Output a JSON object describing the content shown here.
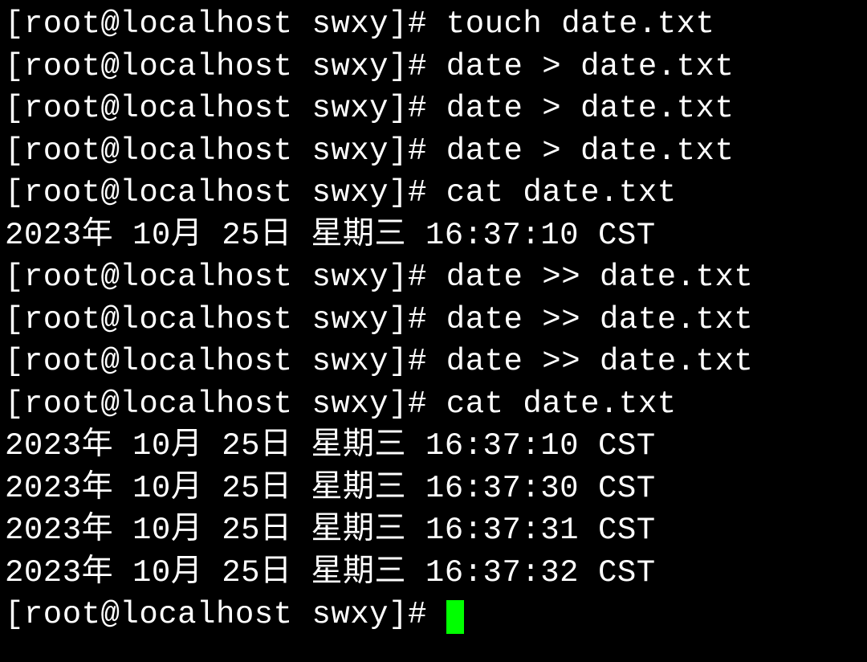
{
  "lines": {
    "l0": "[root@localhost swxy]# touch date.txt",
    "l1": "[root@localhost swxy]# date > date.txt",
    "l2": "[root@localhost swxy]# date > date.txt",
    "l3": "[root@localhost swxy]# date > date.txt",
    "l4": "[root@localhost swxy]# cat date.txt",
    "l5": "2023年 10月 25日 星期三 16:37:10 CST",
    "l6": "[root@localhost swxy]# date >> date.txt",
    "l7": "[root@localhost swxy]# date >> date.txt",
    "l8": "[root@localhost swxy]# date >> date.txt",
    "l9": "[root@localhost swxy]# cat date.txt",
    "l10": "2023年 10月 25日 星期三 16:37:10 CST",
    "l11": "2023年 10月 25日 星期三 16:37:30 CST",
    "l12": "2023年 10月 25日 星期三 16:37:31 CST",
    "l13": "2023年 10月 25日 星期三 16:37:32 CST",
    "l14": "[root@localhost swxy]# "
  }
}
